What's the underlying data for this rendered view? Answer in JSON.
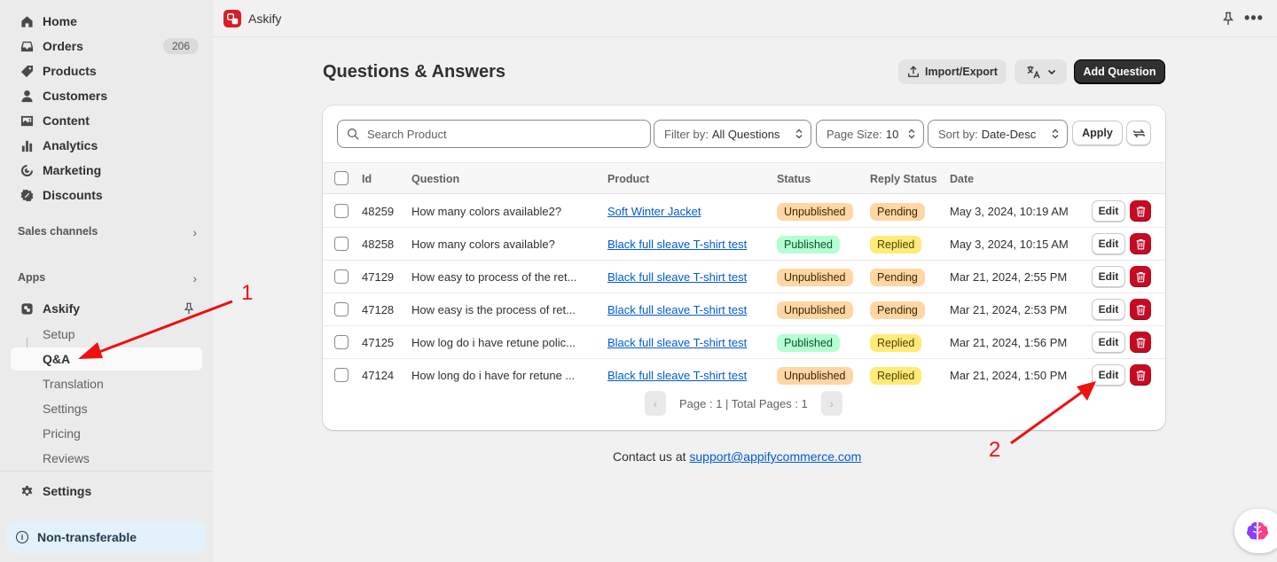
{
  "sidebar": {
    "home": "Home",
    "orders": "Orders",
    "orders_count": "206",
    "products": "Products",
    "customers": "Customers",
    "content": "Content",
    "analytics": "Analytics",
    "marketing": "Marketing",
    "discounts": "Discounts",
    "sales_channels": "Sales channels",
    "apps": "Apps",
    "app_name": "Askify",
    "sub_items": [
      "Setup",
      "Q&A",
      "Translation",
      "Settings",
      "Pricing",
      "Reviews"
    ],
    "settings": "Settings",
    "non_transferable": "Non-transferable"
  },
  "topbar": {
    "app_name": "Askify"
  },
  "page": {
    "title": "Questions & Answers",
    "import_export": "Import/Export",
    "add_question": "Add Question"
  },
  "filters": {
    "search_placeholder": "Search Product",
    "filter_label": "Filter by:",
    "filter_value": "All Questions",
    "page_size_label": "Page Size:",
    "page_size_value": "10",
    "sort_label": "Sort by:",
    "sort_value": "Date-Desc",
    "apply": "Apply"
  },
  "table": {
    "headers": [
      "Id",
      "Question",
      "Product",
      "Status",
      "Reply Status",
      "Date"
    ],
    "edit_label": "Edit",
    "rows": [
      {
        "id": "48259",
        "question": "How many colors available2?",
        "product": "Soft Winter Jacket",
        "status": "Unpublished",
        "reply": "Pending",
        "date": "May 3, 2024, 10:19 AM"
      },
      {
        "id": "48258",
        "question": "How many colors available?",
        "product": "Black full sleave T-shirt test",
        "status": "Published",
        "reply": "Replied",
        "date": "May 3, 2024, 10:15 AM"
      },
      {
        "id": "47129",
        "question": "How easy to process of the ret...",
        "product": "Black full sleave T-shirt test",
        "status": "Unpublished",
        "reply": "Pending",
        "date": "Mar 21, 2024, 2:55 PM"
      },
      {
        "id": "47128",
        "question": "How easy is the process of ret...",
        "product": "Black full sleave T-shirt test",
        "status": "Unpublished",
        "reply": "Pending",
        "date": "Mar 21, 2024, 2:53 PM"
      },
      {
        "id": "47125",
        "question": "How log do i have retune polic...",
        "product": "Black full sleave T-shirt test",
        "status": "Published",
        "reply": "Replied",
        "date": "Mar 21, 2024, 1:56 PM"
      },
      {
        "id": "47124",
        "question": "How long do i have for retune ...",
        "product": "Black full sleave T-shirt test",
        "status": "Unpublished",
        "reply": "Replied",
        "date": "Mar 21, 2024, 1:50 PM"
      }
    ]
  },
  "pager": {
    "text": "Page : 1 | Total Pages : 1"
  },
  "footer": {
    "contact_prefix": "Contact us at",
    "email": "support@appifycommerce.com"
  },
  "annotations": {
    "one": "1",
    "two": "2",
    "arrow_color": "#ee1111"
  },
  "colors": {
    "unpublished_bg": "#ffd6a4",
    "published_bg": "#b4fed2",
    "pending_bg": "#ffd6a4",
    "replied_bg": "#ffeb78",
    "delete_red": "#c70a24",
    "brand_red": "#d91f26"
  }
}
